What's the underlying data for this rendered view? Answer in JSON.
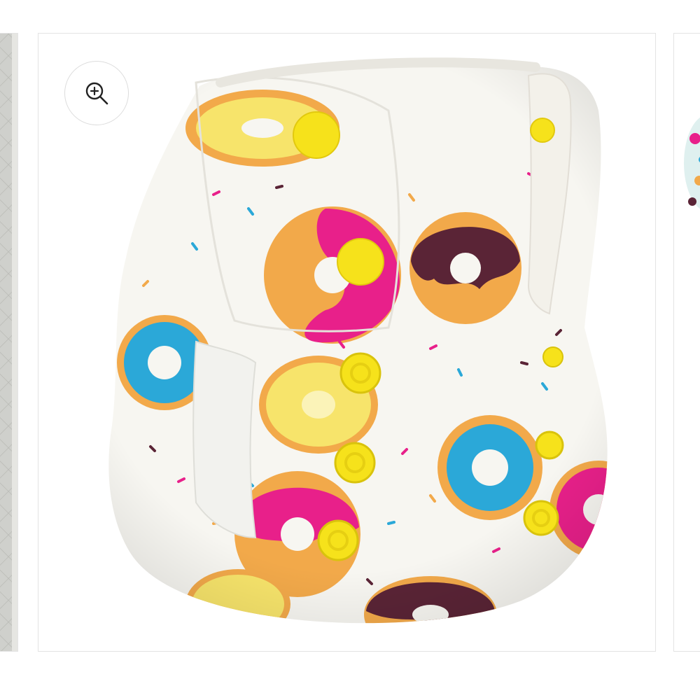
{
  "carousel": {
    "prev_slide": {
      "image": "quilted-gray-fabric"
    },
    "main_slide": {
      "image": "donut-print-cloth-diaper",
      "zoom_icon": "zoom-in-icon"
    },
    "next_slide": {
      "image": "floral-print-cloth-diaper"
    }
  },
  "colors": {
    "snap_yellow": "#f6e21b",
    "diaper_white": "#f7f6f1",
    "donut_dough": "#f2a94a",
    "icing_pink": "#e8208a",
    "icing_blue": "#2ba8d8",
    "icing_chocolate": "#5a2436",
    "icing_lemon": "#f7e46b",
    "border": "#e3e3e3"
  }
}
